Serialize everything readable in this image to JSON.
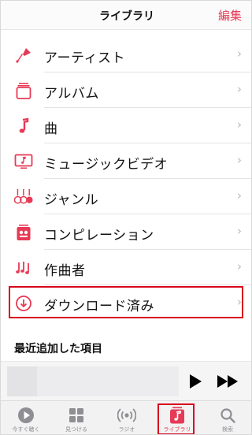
{
  "colors": {
    "accent": "#e63a56",
    "highlight_box": "#d7021c",
    "chevron": "#b8b8bd",
    "tab_inactive": "#8e8e93"
  },
  "header": {
    "title": "ライブラリ",
    "edit_label": "編集"
  },
  "list": {
    "items": [
      {
        "label": "アーティスト",
        "icon": "microphone-icon"
      },
      {
        "label": "アルバム",
        "icon": "album-stack-icon"
      },
      {
        "label": "曲",
        "icon": "music-note-icon"
      },
      {
        "label": "ミュージックビデオ",
        "icon": "music-video-icon"
      },
      {
        "label": "ジャンル",
        "icon": "genre-guitar-icon"
      },
      {
        "label": "コンピレーション",
        "icon": "compilation-icon"
      },
      {
        "label": "作曲者",
        "icon": "composer-notes-icon"
      },
      {
        "label": "ダウンロード済み",
        "icon": "download-circle-icon",
        "highlighted": true
      }
    ],
    "chevron": "›"
  },
  "section": {
    "title": "最近追加した項目"
  },
  "player": {
    "play_icon": "play-icon",
    "forward_icon": "fast-forward-icon"
  },
  "tabs": [
    {
      "label": "今すぐ聴く",
      "icon": "play-circle-icon"
    },
    {
      "label": "見つける",
      "icon": "grid-icon"
    },
    {
      "label": "ラジオ",
      "icon": "radio-waves-icon"
    },
    {
      "label": "ライブラリ",
      "icon": "library-note-icon",
      "active": true
    },
    {
      "label": "検索",
      "icon": "search-icon"
    }
  ]
}
